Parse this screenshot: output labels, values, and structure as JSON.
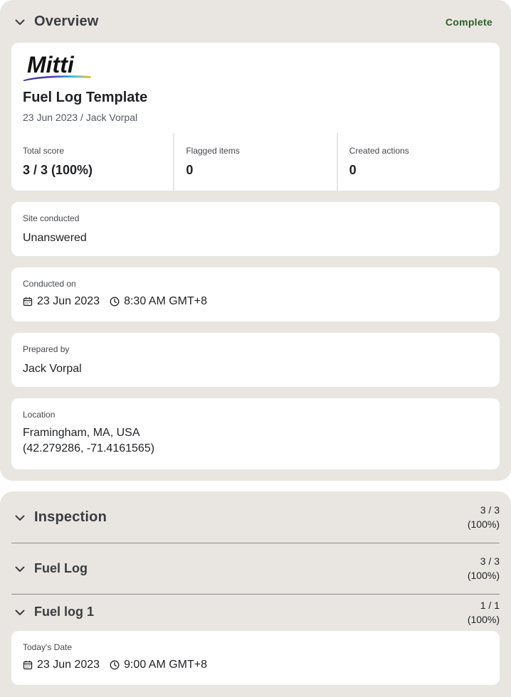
{
  "overview": {
    "title": "Overview",
    "status": "Complete",
    "logo_text": "Mitti",
    "template_name": "Fuel Log Template",
    "subtitle": "23 Jun 2023 / Jack Vorpal",
    "stats": [
      {
        "label": "Total score",
        "value": "3 / 3 (100%)"
      },
      {
        "label": "Flagged items",
        "value": "0"
      },
      {
        "label": "Created actions",
        "value": "0"
      }
    ],
    "site_conducted": {
      "label": "Site conducted",
      "value": "Unanswered"
    },
    "conducted_on": {
      "label": "Conducted on",
      "date": "23 Jun 2023",
      "time": "8:30 AM GMT+8"
    },
    "prepared_by": {
      "label": "Prepared by",
      "value": "Jack Vorpal"
    },
    "location": {
      "label": "Location",
      "line1": "Framingham, MA, USA",
      "line2": "(42.279286, -71.4161565)"
    }
  },
  "inspection": {
    "title": "Inspection",
    "score_line1": "3 / 3",
    "score_line2": "(100%)",
    "fuel_log": {
      "title": "Fuel Log",
      "score_line1": "3 / 3",
      "score_line2": "(100%)"
    },
    "fuel_log_1": {
      "title": "Fuel log 1",
      "score_line1": "1 / 1",
      "score_line2": "(100%)",
      "todays_date": {
        "label": "Today's Date",
        "date": "23 Jun 2023",
        "time": "9:00 AM GMT+8"
      }
    }
  },
  "icons": {
    "chevron": "chevron-down-icon",
    "calendar": "calendar-icon",
    "clock": "clock-icon"
  },
  "colors": {
    "panel_bg": "#e9e6e1",
    "card_bg": "#ffffff",
    "status_green": "#2f5d2a"
  }
}
